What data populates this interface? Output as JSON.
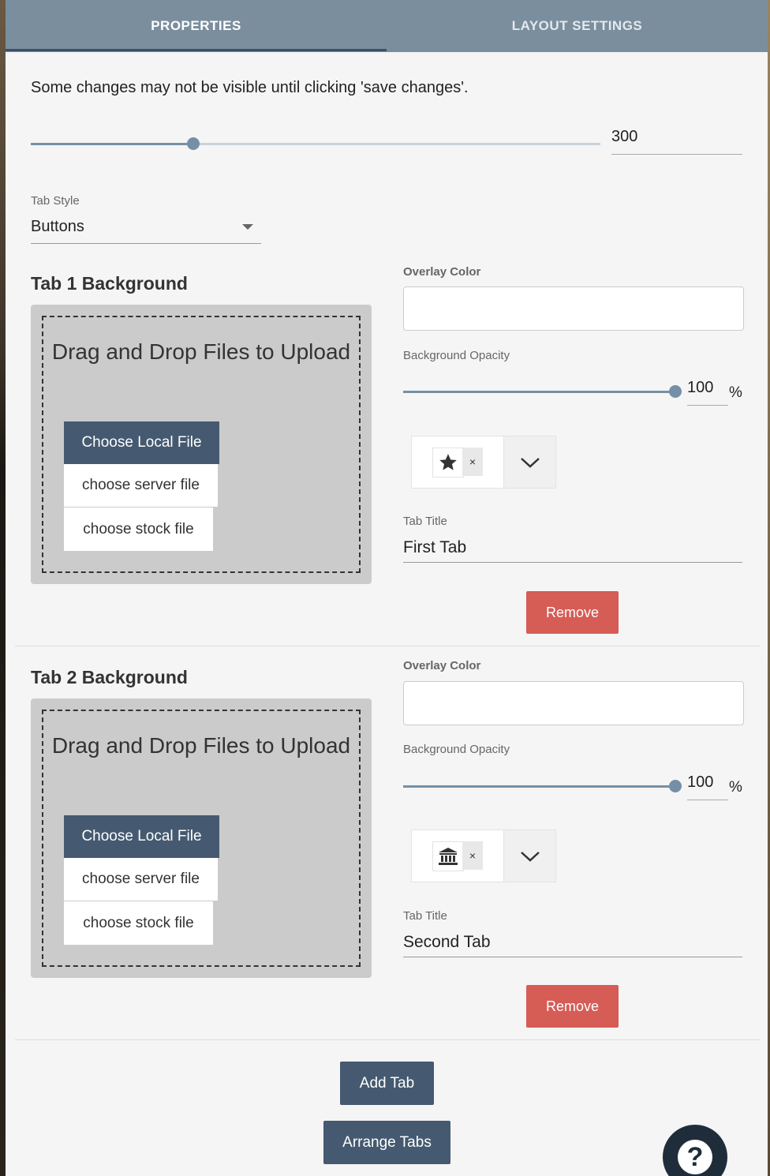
{
  "tabs": {
    "properties": "PROPERTIES",
    "layout_settings": "LAYOUT SETTINGS",
    "active": "PROPERTIES"
  },
  "notice": "Some changes may not be visible until clicking 'save changes'.",
  "height_slider": {
    "value": "300",
    "fraction": 0.285
  },
  "tab_style": {
    "label": "Tab Style",
    "value": "Buttons"
  },
  "tab_items": [
    {
      "heading": "Tab 1 Background",
      "dropzone_text": "Drag and Drop Files to Upload",
      "choose_local": "Choose Local File",
      "choose_server": "choose server file",
      "choose_stock": "choose stock file",
      "overlay_label": "Overlay Color",
      "opacity_label": "Background Opacity",
      "opacity_value": "100",
      "opacity_unit": "%",
      "icon": "star-icon",
      "clear": "×",
      "title_label": "Tab Title",
      "title_value": "First Tab",
      "remove": "Remove"
    },
    {
      "heading": "Tab 2 Background",
      "dropzone_text": "Drag and Drop Files to Upload",
      "choose_local": "Choose Local File",
      "choose_server": "choose server file",
      "choose_stock": "choose stock file",
      "overlay_label": "Overlay Color",
      "opacity_label": "Background Opacity",
      "opacity_value": "100",
      "opacity_unit": "%",
      "icon": "bank-icon",
      "clear": "×",
      "title_label": "Tab Title",
      "title_value": "Second Tab",
      "remove": "Remove"
    }
  ],
  "actions": {
    "add_tab": "Add Tab",
    "arrange_tabs": "Arrange Tabs"
  },
  "help": "?",
  "colors": {
    "header": "#7b8e9e",
    "primary": "#455a70",
    "danger": "#d65c56",
    "slider": "#7590a6"
  }
}
